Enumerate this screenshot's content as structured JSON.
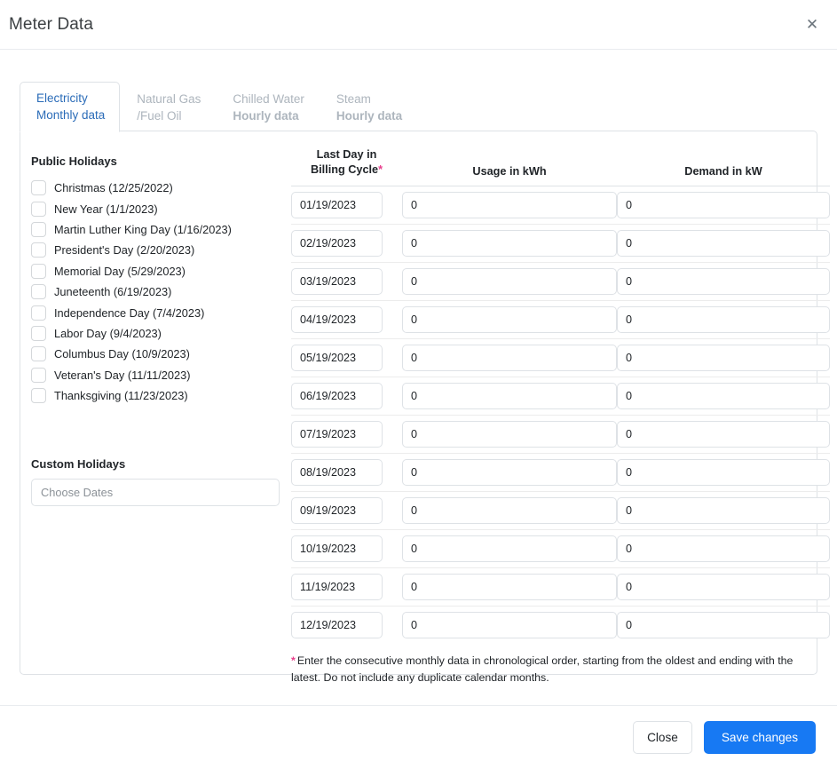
{
  "window": {
    "title": "Meter Data",
    "close_icon": "close-x-icon",
    "close_label": "✕"
  },
  "tabs": [
    {
      "line1": "Electricity",
      "line2": "Monthly data",
      "active": true,
      "bold_line2": false
    },
    {
      "line1": "Natural Gas",
      "line2": "/Fuel Oil",
      "active": false,
      "bold_line2": false
    },
    {
      "line1": "Chilled Water",
      "line2": "Hourly data",
      "active": false,
      "bold_line2": true
    },
    {
      "line1": "Steam",
      "line2": "Hourly data",
      "active": false,
      "bold_line2": true
    }
  ],
  "holidays": {
    "section_title": "Public Holidays",
    "items": [
      {
        "label": "Christmas (12/25/2022)",
        "checked": false
      },
      {
        "label": "New Year (1/1/2023)",
        "checked": false
      },
      {
        "label": "Martin Luther King Day (1/16/2023)",
        "checked": false
      },
      {
        "label": "President's Day (2/20/2023)",
        "checked": false
      },
      {
        "label": "Memorial Day (5/29/2023)",
        "checked": false
      },
      {
        "label": "Juneteenth (6/19/2023)",
        "checked": false
      },
      {
        "label": "Independence Day (7/4/2023)",
        "checked": false
      },
      {
        "label": "Labor Day (9/4/2023)",
        "checked": false
      },
      {
        "label": "Columbus Day (10/9/2023)",
        "checked": false
      },
      {
        "label": "Veteran's Day (11/11/2023)",
        "checked": false
      },
      {
        "label": "Thanksgiving (11/23/2023)",
        "checked": false
      }
    ]
  },
  "custom_holidays": {
    "section_title": "Custom Holidays",
    "input_value": "",
    "input_placeholder": "Choose Dates"
  },
  "table": {
    "headers": {
      "date_line1": "Last Day in",
      "date_line2": "Billing Cycle",
      "date_required_marker": "*",
      "usage": "Usage in kWh",
      "demand": "Demand in kW"
    },
    "rows": [
      {
        "date": "01/19/2023",
        "usage": "0",
        "demand": "0"
      },
      {
        "date": "02/19/2023",
        "usage": "0",
        "demand": "0"
      },
      {
        "date": "03/19/2023",
        "usage": "0",
        "demand": "0"
      },
      {
        "date": "04/19/2023",
        "usage": "0",
        "demand": "0"
      },
      {
        "date": "05/19/2023",
        "usage": "0",
        "demand": "0"
      },
      {
        "date": "06/19/2023",
        "usage": "0",
        "demand": "0"
      },
      {
        "date": "07/19/2023",
        "usage": "0",
        "demand": "0"
      },
      {
        "date": "08/19/2023",
        "usage": "0",
        "demand": "0"
      },
      {
        "date": "09/19/2023",
        "usage": "0",
        "demand": "0"
      },
      {
        "date": "10/19/2023",
        "usage": "0",
        "demand": "0"
      },
      {
        "date": "11/19/2023",
        "usage": "0",
        "demand": "0"
      },
      {
        "date": "12/19/2023",
        "usage": "0",
        "demand": "0"
      }
    ],
    "footnote_marker": "*",
    "footnote": "Enter the consecutive monthly data in chronological order, starting from the oldest and ending with the latest. Do not include any duplicate calendar months."
  },
  "footer": {
    "close_label": "Close",
    "save_label": "Save changes"
  },
  "colors": {
    "primary": "#1779f3",
    "active_tab_text": "#2b6cb8",
    "required_marker": "#e83e8c",
    "border": "#dee2e6",
    "muted_text": "#adb5bd"
  }
}
